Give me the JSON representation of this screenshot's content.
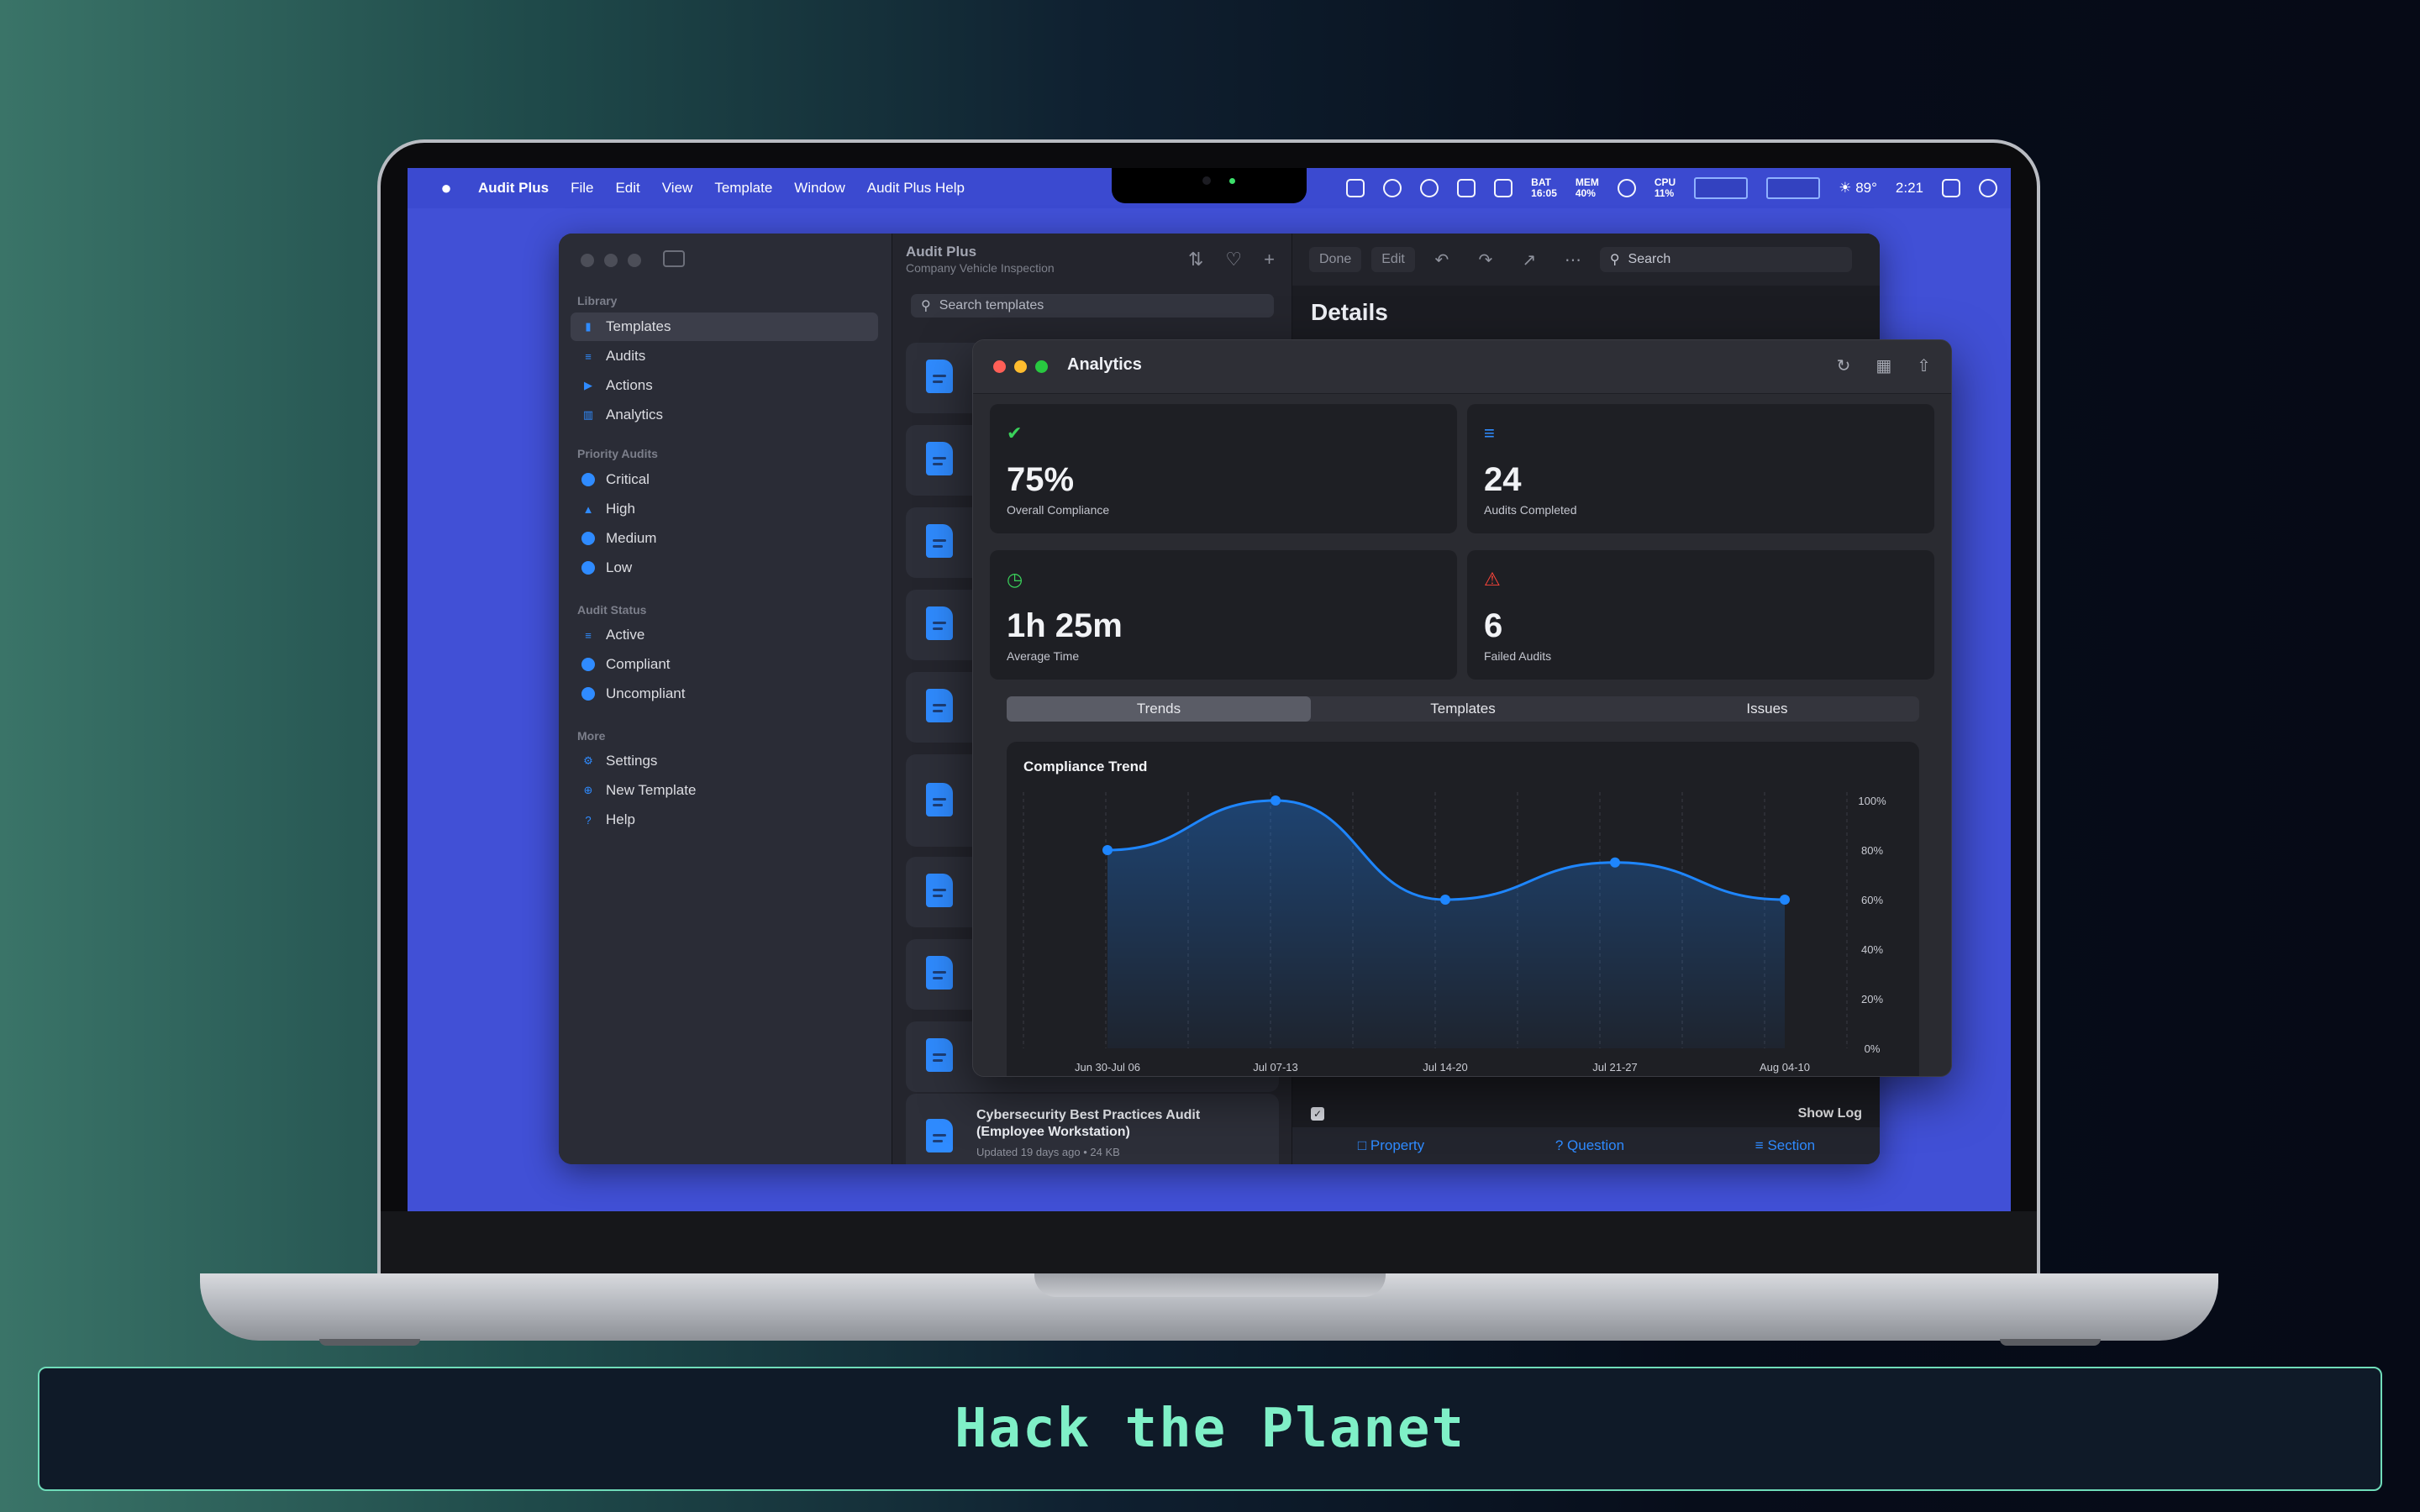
{
  "menubar": {
    "app": "Audit Plus",
    "menus": [
      "File",
      "Edit",
      "View",
      "Template",
      "Window",
      "Audit Plus Help"
    ],
    "bat_label": "BAT",
    "bat_value": "16:05",
    "mem_label": "MEM",
    "mem_value": "40%",
    "cpu_label": "CPU",
    "cpu_value": "11%",
    "weather": "89°",
    "clock": "2:21"
  },
  "sidebar": {
    "library_heading": "Library",
    "library": [
      "Templates",
      "Audits",
      "Actions",
      "Analytics"
    ],
    "priority_heading": "Priority Audits",
    "priority": [
      "Critical",
      "High",
      "Medium",
      "Low"
    ],
    "status_heading": "Audit Status",
    "status": [
      "Active",
      "Compliant",
      "Uncompliant"
    ],
    "more_heading": "More",
    "more": [
      "Settings",
      "New Template",
      "Help"
    ]
  },
  "list": {
    "title": "Audit Plus",
    "subtitle": "Company Vehicle Inspection",
    "search_placeholder": "Search templates",
    "last_card": {
      "title": "Cybersecurity Best Practices Audit (Employee Workstation)",
      "meta": "Updated 19 days ago • 24 KB"
    }
  },
  "detail": {
    "done": "Done",
    "edit": "Edit",
    "search": "Search",
    "title": "Details",
    "show_log": "Show Log",
    "bottom": [
      "Property",
      "Question",
      "Section"
    ]
  },
  "analytics": {
    "title": "Analytics",
    "tiles": [
      {
        "value": "75%",
        "label": "Overall Compliance",
        "icon": "shield-check-icon",
        "color": "#3ad15a"
      },
      {
        "value": "24",
        "label": "Audits Completed",
        "icon": "checklist-icon",
        "color": "#2f8bff"
      },
      {
        "value": "1h 25m",
        "label": "Average Time",
        "icon": "clock-icon",
        "color": "#3ad15a"
      },
      {
        "value": "6",
        "label": "Failed Audits",
        "icon": "warning-icon",
        "color": "#ff453a"
      }
    ],
    "tabs": [
      "Trends",
      "Templates",
      "Issues"
    ],
    "active_tab": "Trends"
  },
  "chart_data": {
    "type": "area",
    "title": "Compliance Trend",
    "categories": [
      "Jun 30-Jul 06",
      "Jul 07-13",
      "Jul 14-20",
      "Jul 21-27",
      "Aug 04-10"
    ],
    "values": [
      80,
      100,
      60,
      75,
      60
    ],
    "ylim": [
      0,
      100
    ],
    "yticks": [
      "100%",
      "80%",
      "60%",
      "40%",
      "20%",
      "0%"
    ],
    "grid": true,
    "color": "#1e86ff"
  },
  "banner": {
    "text": "Hack the Planet"
  }
}
